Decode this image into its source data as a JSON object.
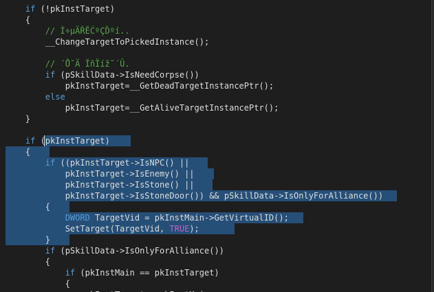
{
  "colors": {
    "background": "#1e1e1e",
    "default_text": "#dcdcdc",
    "keyword": "#569cd6",
    "comment": "#57a64a",
    "macro": "#bd63c5",
    "selection": "#264f78"
  },
  "editor": {
    "lines": [
      [
        {
          "t": "    "
        },
        {
          "t": "if",
          "k": "kw"
        },
        {
          "t": " (!pkInstTarget)"
        }
      ],
      [
        {
          "t": "    {"
        }
      ],
      [
        {
          "t": "        "
        },
        {
          "t": "// Ì÷µÄŘĔĆºÇĎºí..",
          "k": "cm"
        }
      ],
      [
        {
          "t": "        __ChangeTargetToPickedInstance();"
        }
      ],
      [
        {
          "t": ""
        }
      ],
      [
        {
          "t": "        "
        },
        {
          "t": "// ´Ů˘Ä ĬñÏíž˘´Û.",
          "k": "cm"
        }
      ],
      [
        {
          "t": "        "
        },
        {
          "t": "if",
          "k": "kw"
        },
        {
          "t": " (pSkillData->IsNeedCorpse())"
        }
      ],
      [
        {
          "t": "            pkInstTarget=__GetDeadTargetInstancePtr();"
        }
      ],
      [
        {
          "t": "        "
        },
        {
          "t": "else",
          "k": "kw"
        }
      ],
      [
        {
          "t": "            pkInstTarget=__GetAliveTargetInstancePtr();"
        }
      ],
      [
        {
          "t": "    }"
        }
      ],
      [
        {
          "t": ""
        }
      ],
      [
        {
          "t": "    "
        },
        {
          "t": "if",
          "k": "kw"
        },
        {
          "t": " (pkInstTarget)"
        }
      ],
      [
        {
          "t": "    {"
        }
      ],
      [
        {
          "t": "        "
        },
        {
          "t": "if",
          "k": "kw"
        },
        {
          "t": " ((pkInstTarget->IsNPC() ||"
        }
      ],
      [
        {
          "t": "            pkInstTarget->IsEnemy() ||"
        }
      ],
      [
        {
          "t": "            pkInstTarget->IsStone() ||"
        }
      ],
      [
        {
          "t": "            pkInstTarget->IsStoneDoor()) && pSkillData->IsOnlyForAlliance())"
        }
      ],
      [
        {
          "t": "        {"
        }
      ],
      [
        {
          "t": "            "
        },
        {
          "t": "DWORD",
          "k": "kw"
        },
        {
          "t": " TargetVid = pkInstMain->GetVirtualID();"
        }
      ],
      [
        {
          "t": "            SetTarget(TargetVid, "
        },
        {
          "t": "TRUE",
          "k": "mac"
        },
        {
          "t": ");"
        }
      ],
      [
        {
          "t": "        }"
        }
      ],
      [
        {
          "t": "        "
        },
        {
          "t": "if",
          "k": "kw"
        },
        {
          "t": " (pSkillData->IsOnlyForAlliance())"
        }
      ],
      [
        {
          "t": "        {"
        }
      ],
      [
        {
          "t": "            "
        },
        {
          "t": "if",
          "k": "kw"
        },
        {
          "t": " (pkInstMain == pkInstTarget)"
        }
      ],
      [
        {
          "t": "            {"
        }
      ],
      [
        {
          "t": "                pkInstTarget = pkInstMain;"
        }
      ]
    ]
  }
}
